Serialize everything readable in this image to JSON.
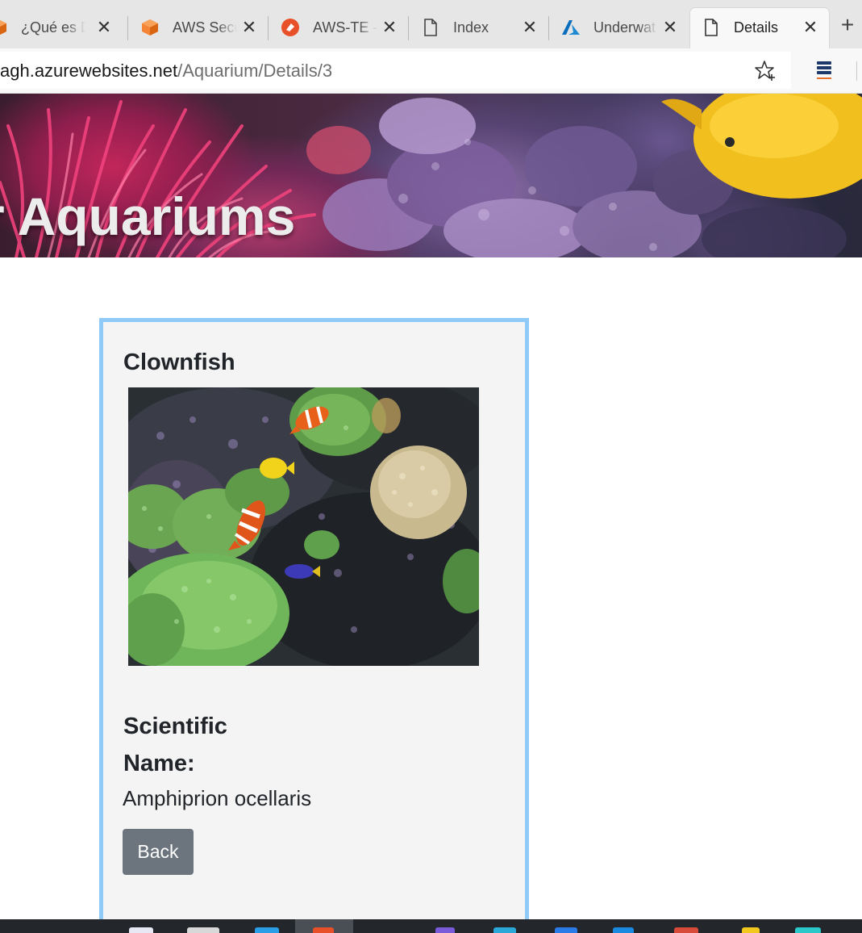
{
  "browser": {
    "tabs": [
      {
        "title": "¿Qué es D",
        "icon": "aws-cube-icon",
        "active": false
      },
      {
        "title": "AWS Secu",
        "icon": "aws-cube-icon",
        "active": false
      },
      {
        "title": "AWS-TE -",
        "icon": "gitlab-red-icon",
        "active": false
      },
      {
        "title": "Index",
        "icon": "page-icon",
        "active": false
      },
      {
        "title": "Underwat",
        "icon": "azure-icon",
        "active": false
      },
      {
        "title": "Details",
        "icon": "page-icon",
        "active": true
      }
    ],
    "close_glyph": "✕",
    "new_tab_glyph": "+",
    "url_host": "agh.azurewebsites.net",
    "url_path": "/Aquarium/Details/3"
  },
  "banner": {
    "title": "r Aquariums"
  },
  "details": {
    "name": "Clownfish",
    "scientific_label": "Scientific Name:",
    "scientific_value": "Amphiprion ocellaris",
    "back_label": "Back"
  },
  "colors": {
    "card_border": "#90caf9",
    "button_bg": "#6c757d",
    "card_bg": "#f4f4f4"
  }
}
